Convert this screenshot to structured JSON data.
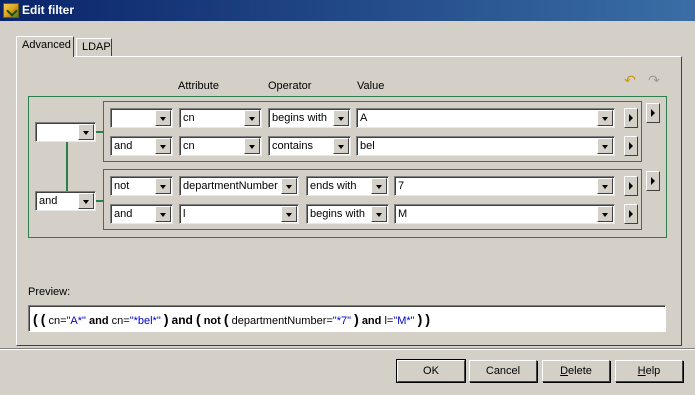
{
  "window": {
    "title": "Edit filter"
  },
  "tabs": [
    {
      "label": "Advanced",
      "active": true
    },
    {
      "label": "LDAP",
      "active": false
    }
  ],
  "headers": {
    "attribute": "Attribute",
    "operator": "Operator",
    "value": "Value"
  },
  "toolbar": {
    "undo_icon": "undo-arrow-icon",
    "redo_icon": "redo-arrow-icon"
  },
  "outer_group": {
    "logic": "and"
  },
  "group1": {
    "logic": "",
    "rows": [
      {
        "logic": "",
        "attribute": "cn",
        "operator": "begins with",
        "value": "A"
      },
      {
        "logic": "and",
        "attribute": "cn",
        "operator": "contains",
        "value": "bel"
      }
    ]
  },
  "group2": {
    "logic": "and",
    "rows": [
      {
        "logic": "not",
        "attribute": "departmentNumber",
        "operator": "ends with",
        "value": "7"
      },
      {
        "logic": "and",
        "attribute": "l",
        "operator": "begins with",
        "value": "M"
      }
    ]
  },
  "preview": {
    "label": "Preview:",
    "tokens": {
      "p1": "(",
      "p2": "(",
      "a1": "cn=",
      "s1": "\"A*\"",
      "k1": "and",
      "a2": "cn=",
      "s2": "\"*bel*\"",
      "p3": ")",
      "k2": "and",
      "p4": "(",
      "k3": "not",
      "p5": "(",
      "a3": "departmentNumber=",
      "s3": "\"*7\"",
      "p6": ")",
      "k4": "and",
      "a4": "l=",
      "s4": "\"M*\"",
      "p7": ")",
      "p8": ")"
    }
  },
  "buttons": {
    "ok": "OK",
    "cancel": "Cancel",
    "delete_first": "D",
    "delete_rest": "elete",
    "help_first": "H",
    "help_rest": "elp"
  }
}
